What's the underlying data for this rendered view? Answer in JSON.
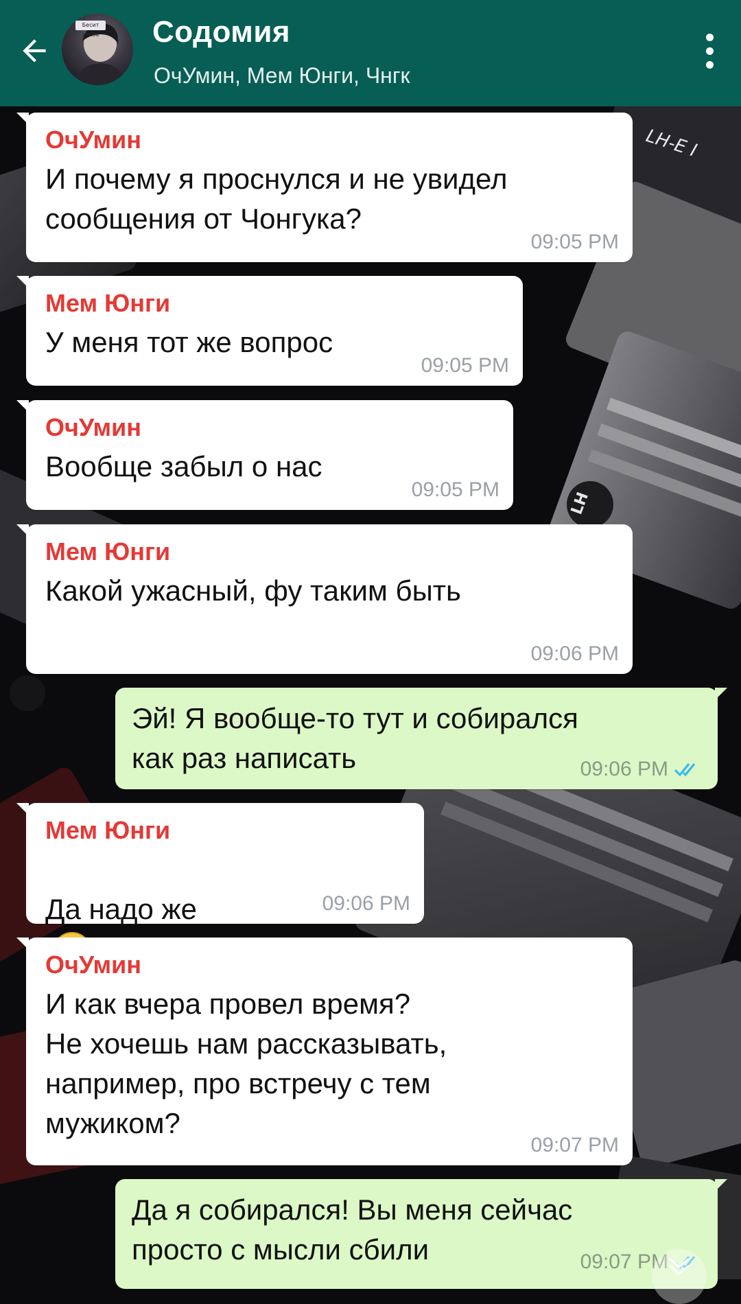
{
  "header": {
    "title": "Содомия",
    "subtitle": "ОчУмин, Мем Юнги, Чнгк",
    "avatar_sticker": "Бесит учеба"
  },
  "colors": {
    "header_bg": "#075e54",
    "incoming_bubble": "#ffffff",
    "outgoing_bubble": "#dcf8c6",
    "sender_name": "#e53935",
    "read_ticks": "#34b7f1"
  },
  "icons": {
    "back": "arrow-left-icon",
    "menu": "more-vert-icon",
    "read": "double-check-icon",
    "emoji": "face-rolling-eyes-icon"
  },
  "wallpaper": {
    "label_1": "LH-E I",
    "label_2": "LH"
  },
  "messages": [
    {
      "direction": "in",
      "sender": "ОчУмин",
      "text": "И почему я проснулся и не увидел\nсообщения от Чонгука?",
      "time": "09:05 PM"
    },
    {
      "direction": "in",
      "sender": "Мем Юнги",
      "text": "У меня тот же вопрос",
      "time": "09:05 PM"
    },
    {
      "direction": "in",
      "sender": "ОчУмин",
      "text": "Вообще забыл о нас",
      "time": "09:05 PM"
    },
    {
      "direction": "in",
      "sender": "Мем Юнги",
      "text": "Какой ужасный, фу таким быть",
      "time": "09:06 PM"
    },
    {
      "direction": "out",
      "text": "Эй! Я вообще-то тут и собирался\nкак раз написать",
      "time": "09:06 PM"
    },
    {
      "direction": "in",
      "sender": "Мем Юнги",
      "text": "Да надо же",
      "time": "09:06 PM"
    },
    {
      "direction": "in",
      "sender": "ОчУмин",
      "text": "И как вчера провел время?\nНе хочешь нам рассказывать,\nнапример, про встречу с тем\nмужиком?",
      "time": "09:07 PM"
    },
    {
      "direction": "out",
      "text": "Да я собирался! Вы меня сейчас\nпросто с мысли сбили",
      "time": "09:07 PM"
    }
  ]
}
